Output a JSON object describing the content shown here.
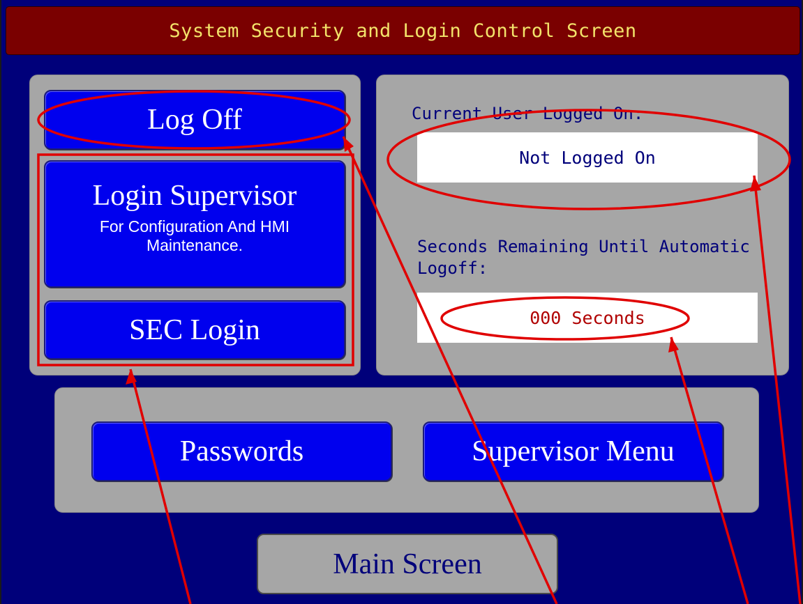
{
  "title": "System Security and Login Control Screen",
  "left_panel": {
    "log_off_label": "Log Off",
    "login_supervisor_label": "Login Supervisor",
    "login_supervisor_sub": "For Configuration And HMI Maintenance.",
    "sec_login_label": "SEC Login"
  },
  "right_panel": {
    "current_user_label": "Current User Logged On:",
    "current_user_value": "Not Logged On",
    "seconds_label": "Seconds Remaining Until Automatic Logoff:",
    "seconds_value": "000 Seconds"
  },
  "bottom_panel": {
    "passwords_label": "Passwords",
    "supervisor_menu_label": "Supervisor Menu"
  },
  "main_screen_label": "Main Screen",
  "colors": {
    "background": "#00007a",
    "title_bar": "#7a0000",
    "title_text": "#f3e36a",
    "button_blue": "#0000ee",
    "panel_gray": "#a6a6a6",
    "annotation_red": "#e00000",
    "countdown_text": "#b00000"
  }
}
